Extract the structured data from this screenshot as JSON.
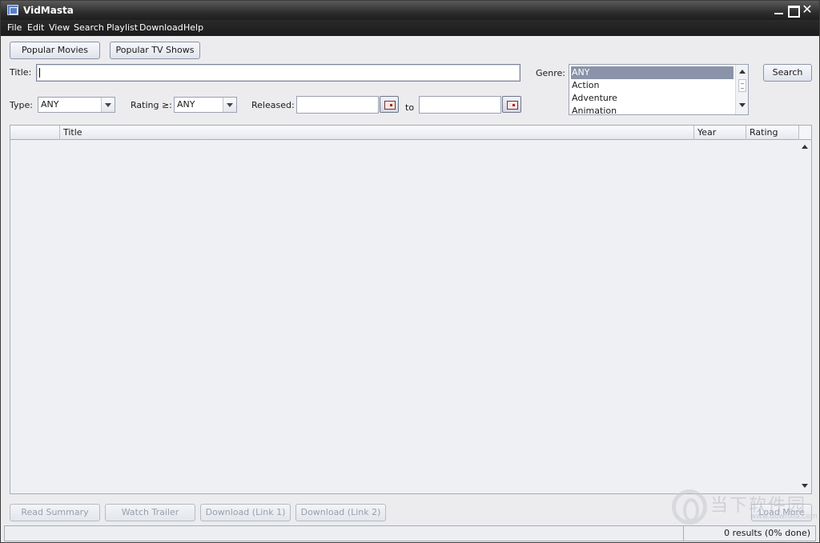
{
  "window": {
    "title": "VidMasta"
  },
  "menu": [
    "File",
    "Edit",
    "View",
    "Search",
    "Playlist",
    "Download",
    "Help"
  ],
  "toolbar": {
    "popular_movies": "Popular Movies",
    "popular_tv": "Popular TV Shows"
  },
  "search": {
    "title_label": "Title:",
    "title_value": "",
    "genre_label": "Genre:",
    "genres": [
      "ANY",
      "Action",
      "Adventure",
      "Animation"
    ],
    "selected_genre": "ANY",
    "search_button": "Search",
    "type_label": "Type:",
    "type_value": "ANY",
    "rating_label": "Rating ≥:",
    "rating_value": "ANY",
    "released_label": "Released:",
    "released_from": "",
    "to_label": "to",
    "released_to": ""
  },
  "table": {
    "columns": [
      "",
      "Title",
      "Year",
      "Rating"
    ],
    "rows": []
  },
  "actions": {
    "read_summary": "Read Summary",
    "watch_trailer": "Watch Trailer",
    "download_link1": "Download (Link 1)",
    "download_link2": "Download (Link 2)",
    "load_more": "Load More"
  },
  "status": {
    "text": "0 results (0% done)"
  },
  "watermark": {
    "text": "当下软件园",
    "url": "www.downxia.com"
  }
}
